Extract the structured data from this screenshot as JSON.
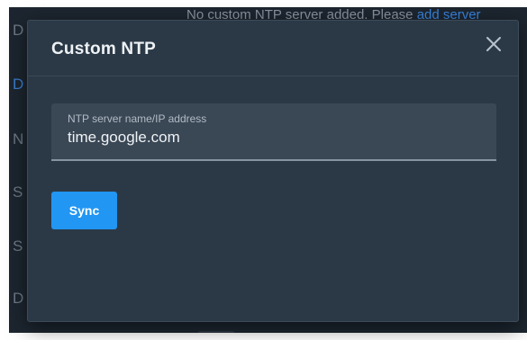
{
  "background": {
    "notice_text": "No custom NTP server added. Please",
    "notice_link": "add server",
    "row_letters": [
      "D",
      "D",
      "N",
      "S",
      "S",
      "D"
    ]
  },
  "modal": {
    "title": "Custom NTP",
    "close_icon": "close-icon",
    "field": {
      "label": "NTP server name/IP address",
      "value": "time.google.com"
    },
    "sync_label": "Sync"
  },
  "colors": {
    "modal_bg": "#2b3947",
    "backdrop": "#1d2630",
    "accent": "#2196f3",
    "field_bg": "#3a4755"
  }
}
